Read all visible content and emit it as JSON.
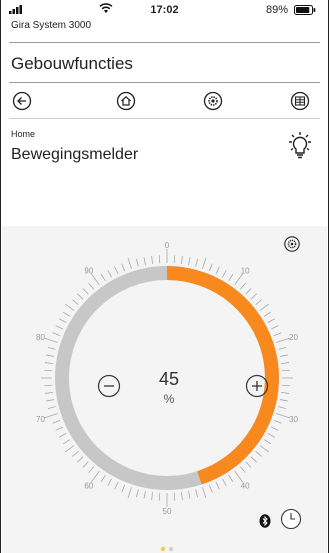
{
  "status_bar": {
    "time": "17:02",
    "battery_percent": "89%",
    "battery_level": 0.89,
    "signal_icon": "signal-bars-icon",
    "wifi_icon": "wifi-icon",
    "battery_icon": "battery-icon"
  },
  "app": {
    "name": "Gira System 3000"
  },
  "header": {
    "title": "Gebouwfuncties"
  },
  "nav": {
    "back_icon": "back-arrow-icon",
    "home_icon": "home-icon",
    "functions_icon": "gear-icon",
    "grid_icon": "grid-icon"
  },
  "device": {
    "breadcrumb": "Home",
    "title": "Bewegingsmelder",
    "light_icon": "light-bulb-icon"
  },
  "dial": {
    "value": "45",
    "unit": "%",
    "value_fraction": 0.45,
    "tick_labels": [
      "0",
      "10",
      "20",
      "30",
      "40",
      "50",
      "60",
      "70",
      "80",
      "90"
    ],
    "accent_color": "#f7891f",
    "track_color": "#c7c7c7",
    "minus_icon": "minus-circle-icon",
    "plus_icon": "plus-circle-icon",
    "settings_icon": "gear-icon"
  },
  "footer": {
    "bluetooth_icon": "bluetooth-icon",
    "clock_icon": "clock-icon"
  }
}
